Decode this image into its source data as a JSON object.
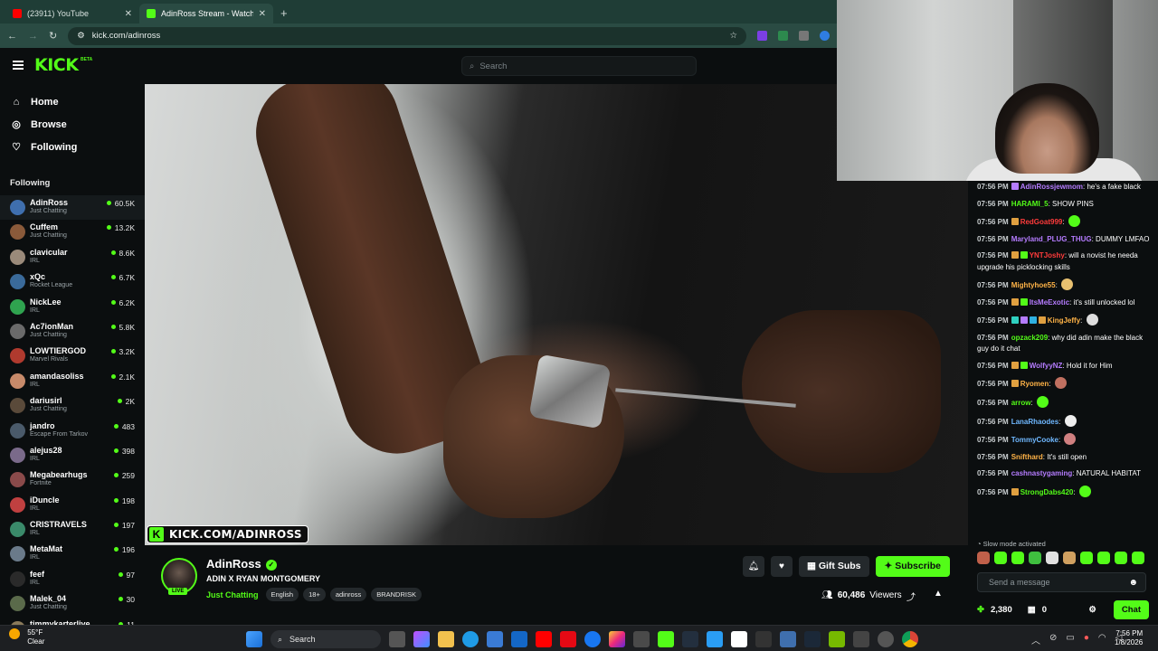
{
  "browser": {
    "tabs": [
      {
        "label": "(23911) YouTube",
        "active": false,
        "favicon_color": "#ff0000"
      },
      {
        "label": "AdinRoss Stream - Watch Li",
        "active": true,
        "favicon_color": "#53fc18"
      }
    ],
    "url": "kick.com/adinross"
  },
  "kick": {
    "logo": "KICK",
    "logo_badge": "BETA",
    "search_placeholder": "Search",
    "accent": "#53fc18",
    "nav": [
      {
        "label": "Home",
        "icon": "home-icon"
      },
      {
        "label": "Browse",
        "icon": "compass-icon"
      },
      {
        "label": "Following",
        "icon": "heart-icon"
      }
    ],
    "following_title": "Following",
    "following": [
      {
        "name": "AdinRoss",
        "category": "Just Chatting",
        "viewers": "60.5K",
        "color": "#3f6fae"
      },
      {
        "name": "Cuffem",
        "category": "Just Chatting",
        "viewers": "13.2K",
        "color": "#8a5a3a"
      },
      {
        "name": "clavicular",
        "category": "IRL",
        "viewers": "8.6K",
        "color": "#9a8a7a"
      },
      {
        "name": "xQc",
        "category": "Rocket League",
        "viewers": "6.7K",
        "color": "#3a6a9a"
      },
      {
        "name": "NickLee",
        "category": "IRL",
        "viewers": "6.2K",
        "color": "#2fa34f"
      },
      {
        "name": "Ac7ionMan",
        "category": "Just Chatting",
        "viewers": "5.8K",
        "color": "#6a6a6a"
      },
      {
        "name": "LOWTIERGOD",
        "category": "Marvel Rivals",
        "viewers": "3.2K",
        "color": "#b03a2e"
      },
      {
        "name": "amandasoliss",
        "category": "IRL",
        "viewers": "2.1K",
        "color": "#c78a6a"
      },
      {
        "name": "dariusirl",
        "category": "Just Chatting",
        "viewers": "2K",
        "color": "#5a4a3a"
      },
      {
        "name": "jandro",
        "category": "Escape From Tarkov",
        "viewers": "483",
        "color": "#4a5a6a"
      },
      {
        "name": "alejus28",
        "category": "IRL",
        "viewers": "398",
        "color": "#7a6a8a"
      },
      {
        "name": "Megabearhugs",
        "category": "Fortnite",
        "viewers": "259",
        "color": "#8a4a4a"
      },
      {
        "name": "iDuncle",
        "category": "IRL",
        "viewers": "198",
        "color": "#c04040"
      },
      {
        "name": "CRISTRAVELS",
        "category": "IRL",
        "viewers": "197",
        "color": "#3a8a6a"
      },
      {
        "name": "MetaMat",
        "category": "IRL",
        "viewers": "196",
        "color": "#6a7a8a"
      },
      {
        "name": "feef",
        "category": "IRL",
        "viewers": "97",
        "color": "#2a2a2a"
      },
      {
        "name": "Malek_04",
        "category": "Just Chatting",
        "viewers": "30",
        "color": "#5a6a4a"
      },
      {
        "name": "timmykarterlive",
        "category": "",
        "viewers": "11",
        "color": "#8a7a5a"
      }
    ],
    "watermark": "KICK.COM/ADINROSS",
    "stream": {
      "streamer": "AdinRoss",
      "live_label": "LIVE",
      "title": "ADIN X RYAN MONTGOMERY",
      "category": "Just Chatting",
      "tags": [
        "English",
        "18+",
        "adinross",
        "BRANDRISK"
      ],
      "gift_label": "Gift Subs",
      "subscribe_label": "Subscribe",
      "viewers": "60,486",
      "viewers_label": "Viewers"
    },
    "chat": {
      "messages": [
        {
          "time": "07:56 PM",
          "user": "AdinRossjewmom",
          "color": "#b57cff",
          "text": "he's a fake black",
          "badges": [
            "#b57cff"
          ]
        },
        {
          "time": "07:56 PM",
          "user": "HARAMI_5",
          "color": "#53fc18",
          "text": "SHOW PINS",
          "badges": []
        },
        {
          "time": "07:56 PM",
          "user": "RedGoat999",
          "color": "#ff3b3b",
          "text": "",
          "badges": [
            "#e0a040"
          ],
          "emote": "#53fc18"
        },
        {
          "time": "07:56 PM",
          "user": "Maryland_PLUG_THUG",
          "color": "#b57cff",
          "text": "DUMMY LMFAO",
          "badges": []
        },
        {
          "time": "07:56 PM",
          "user": "YNTJoshy",
          "color": "#ff3b3b",
          "text": "will a novist he needa upgrade his picklocking skills",
          "badges": [
            "#e0a040",
            "#53fc18"
          ]
        },
        {
          "time": "07:56 PM",
          "user": "Mightyhoe55",
          "color": "#ffb347",
          "text": "",
          "badges": [],
          "emote": "#e8c070"
        },
        {
          "time": "07:56 PM",
          "user": "ItsMeExotic",
          "color": "#b57cff",
          "text": "it's still unlocked lol",
          "badges": [
            "#e0a040",
            "#53fc18"
          ]
        },
        {
          "time": "07:56 PM",
          "user": "KingJeffy",
          "color": "#ffb347",
          "text": "",
          "badges": [
            "#2fd0c0",
            "#b57cff",
            "#2fb0e0",
            "#e0a040"
          ],
          "emote": "#dddddd"
        },
        {
          "time": "07:56 PM",
          "user": "opzack209",
          "color": "#53fc18",
          "text": "why did adin make the black guy do it chat",
          "badges": []
        },
        {
          "time": "07:56 PM",
          "user": "WolfyyNZ",
          "color": "#b57cff",
          "text": "Hold it for Him",
          "badges": [
            "#e0a040",
            "#53fc18"
          ]
        },
        {
          "time": "07:56 PM",
          "user": "Ryomen",
          "color": "#ffb347",
          "text": "",
          "badges": [
            "#e0a040"
          ],
          "emote": "#c07060"
        },
        {
          "time": "07:56 PM",
          "user": "arrow",
          "color": "#53fc18",
          "text": "",
          "badges": [],
          "emote": "#53fc18"
        },
        {
          "time": "07:56 PM",
          "user": "LanaRhaodes",
          "color": "#6fb8ff",
          "text": "",
          "badges": [],
          "emote": "#eeeeee"
        },
        {
          "time": "07:56 PM",
          "user": "TommyCooke",
          "color": "#6fb8ff",
          "text": "",
          "badges": [],
          "emote": "#d08080"
        },
        {
          "time": "07:56 PM",
          "user": "Snifthard",
          "color": "#ffb347",
          "text": "It's still open",
          "badges": []
        },
        {
          "time": "07:56 PM",
          "user": "cashnastygaming",
          "color": "#b57cff",
          "text": "NATURAL HABITAT",
          "badges": []
        },
        {
          "time": "07:56 PM",
          "user": "StrongDabs420",
          "color": "#53fc18",
          "text": "",
          "badges": [
            "#e0a040"
          ],
          "emote": "#53fc18"
        }
      ],
      "slow_mode": "Slow mode activated",
      "placeholder": "Send a message",
      "points": "2,380",
      "count": "0",
      "chat_button": "Chat"
    }
  },
  "taskbar": {
    "weather_temp": "55°F",
    "weather_desc": "Clear",
    "search_label": "Search",
    "time": "7:56 PM",
    "date": "1/8/2026"
  }
}
